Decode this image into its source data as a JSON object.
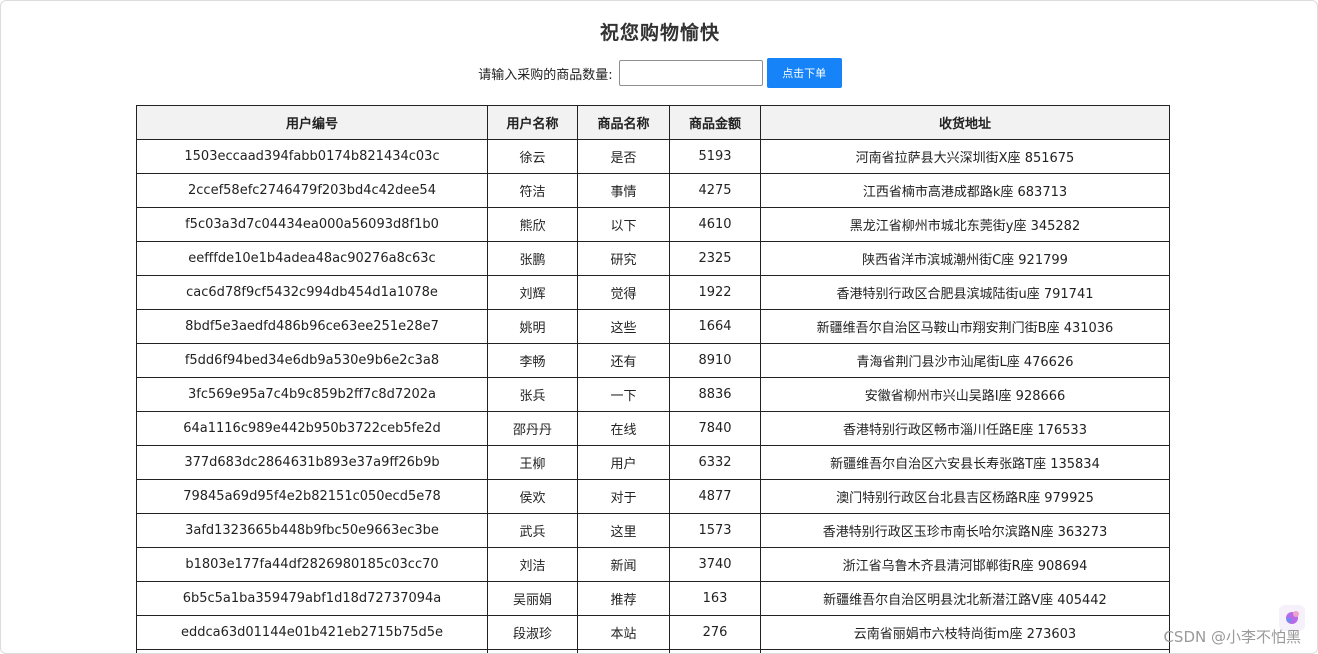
{
  "page": {
    "title": "祝您购物愉快"
  },
  "order_form": {
    "label": "请输入采购的商品数量:",
    "quantity_value": "",
    "button_label": "点击下单"
  },
  "table": {
    "headers": [
      "用户编号",
      "用户名称",
      "商品名称",
      "商品金额",
      "收货地址"
    ],
    "rows": [
      [
        "1503eccaad394fabb0174b821434c03c",
        "徐云",
        "是否",
        "5193",
        "河南省拉萨县大兴深圳街X座 851675"
      ],
      [
        "2ccef58efc2746479f203bd4c42dee54",
        "符洁",
        "事情",
        "4275",
        "江西省楠市高港成都路k座 683713"
      ],
      [
        "f5c03a3d7c04434ea000a56093d8f1b0",
        "熊欣",
        "以下",
        "4610",
        "黑龙江省柳州市城北东莞街y座 345282"
      ],
      [
        "eefffde10e1b4adea48ac90276a8c63c",
        "张鹏",
        "研究",
        "2325",
        "陕西省洋市滨城潮州街C座 921799"
      ],
      [
        "cac6d78f9cf5432c994db454d1a1078e",
        "刘辉",
        "觉得",
        "1922",
        "香港特别行政区合肥县滨城陆街u座 791741"
      ],
      [
        "8bdf5e3aedfd486b96ce63ee251e28e7",
        "姚明",
        "这些",
        "1664",
        "新疆维吾尔自治区马鞍山市翔安荆门街B座 431036"
      ],
      [
        "f5dd6f94bed34e6db9a530e9b6e2c3a8",
        "李畅",
        "还有",
        "8910",
        "青海省荆门县沙市汕尾街L座 476626"
      ],
      [
        "3fc569e95a7c4b9c859b2ff7c8d7202a",
        "张兵",
        "一下",
        "8836",
        "安徽省柳州市兴山吴路I座 928666"
      ],
      [
        "64a1116c989e442b950b3722ceb5fe2d",
        "邵丹丹",
        "在线",
        "7840",
        "香港特别行政区畅市淄川任路E座 176533"
      ],
      [
        "377d683dc2864631b893e37a9ff26b9b",
        "王柳",
        "用户",
        "6332",
        "新疆维吾尔自治区六安县长寿张路T座 135834"
      ],
      [
        "79845a69d95f4e2b82151c050ecd5e78",
        "侯欢",
        "对于",
        "4877",
        "澳门特别行政区台北县吉区杨路R座 979925"
      ],
      [
        "3afd1323665b448b9fbc50e9663ec3be",
        "武兵",
        "这里",
        "1573",
        "香港特别行政区玉珍市南长哈尔滨路N座 363273"
      ],
      [
        "b1803e177fa44df2826980185c03cc70",
        "刘洁",
        "新闻",
        "3740",
        "浙江省乌鲁木齐县清河邯郸街R座 908694"
      ],
      [
        "6b5c5a1ba359479abf1d18d72737094a",
        "吴丽娟",
        "推荐",
        "163",
        "新疆维吾尔自治区明县沈北新潜江路V座 405442"
      ],
      [
        "eddca63d01144e01b421eb2715b75d5e",
        "段淑珍",
        "本站",
        "276",
        "云南省丽娟市六枝特尚街m座 273603"
      ],
      [
        "",
        "",
        "",
        "",
        ""
      ]
    ]
  },
  "watermark": "CSDN @小李不怕黑",
  "colors": {
    "button_bg": "#1683f8",
    "header_bg": "#f2f2f2",
    "border": "#222222"
  },
  "icons": {
    "corner_widget": "assistant-icon"
  }
}
